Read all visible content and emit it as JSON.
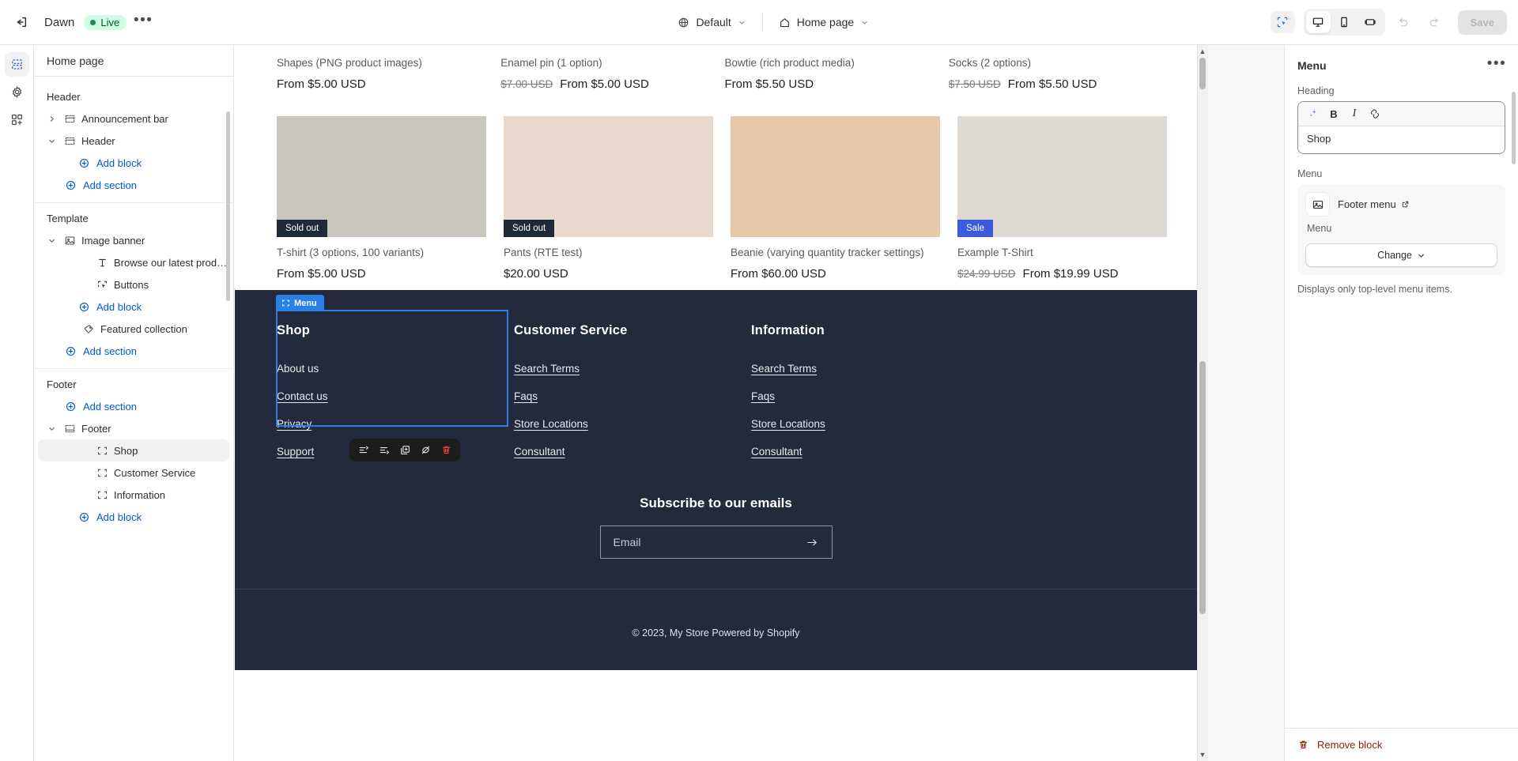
{
  "topbar": {
    "exit_icon": "exit-icon",
    "theme_name": "Dawn",
    "live_label": "Live",
    "more_label": "•••",
    "locale_selector": {
      "icon": "globe-icon",
      "value": "Default",
      "chevron": "chevron-down-icon"
    },
    "page_selector": {
      "icon": "home-icon",
      "value": "Home page",
      "chevron": "chevron-down-icon"
    },
    "view_modes": [
      {
        "name": "select-mode",
        "icon": "cursor-select-icon",
        "active": true
      },
      {
        "name": "desktop",
        "icon": "desktop-icon",
        "active": true
      },
      {
        "name": "mobile",
        "icon": "mobile-icon",
        "active": false
      },
      {
        "name": "fullscreen",
        "icon": "fullwidth-icon",
        "active": false
      }
    ],
    "undo_label": "undo-icon",
    "redo_label": "redo-icon",
    "save_label": "Save"
  },
  "rail": [
    {
      "name": "sections-icon",
      "label": "Sections",
      "active": true
    },
    {
      "name": "gear-icon",
      "label": "Theme settings",
      "active": false
    },
    {
      "name": "apps-icon",
      "label": "Apps",
      "active": false
    }
  ],
  "sidebar": {
    "header_title": "Home page",
    "groups": [
      {
        "title": "Header",
        "rows": [
          {
            "label": "Announcement bar",
            "icon": "section-icon",
            "caret": "chevron-right-icon",
            "indent": 1,
            "selected": false
          },
          {
            "label": "Header",
            "icon": "section-icon",
            "caret": "chevron-down-icon",
            "indent": 1,
            "selected": false
          },
          {
            "label": "Add block",
            "icon": "plus-circle-icon",
            "link": true,
            "indent": 3
          },
          {
            "label": "Add section",
            "icon": "plus-circle-icon",
            "link": true,
            "indent": 2
          }
        ]
      },
      {
        "title": "Template",
        "rows": [
          {
            "label": "Image banner",
            "icon": "image-icon",
            "caret": "chevron-down-icon",
            "indent": 1,
            "selected": false
          },
          {
            "label": "Browse our latest products",
            "icon": "text-icon",
            "indent": 3,
            "selected": false
          },
          {
            "label": "Buttons",
            "icon": "button-icon",
            "indent": 3,
            "selected": false
          },
          {
            "label": "Add block",
            "icon": "plus-circle-icon",
            "link": true,
            "indent": 3
          },
          {
            "label": "Featured collection",
            "icon": "collection-icon",
            "indent": 2,
            "selected": false
          },
          {
            "label": "Add section",
            "icon": "plus-circle-icon",
            "link": true,
            "indent": 2
          }
        ]
      },
      {
        "title": "Footer",
        "rows": [
          {
            "label": "Add section",
            "icon": "plus-circle-icon",
            "link": true,
            "indent": 2
          },
          {
            "label": "Footer",
            "icon": "footer-icon",
            "caret": "chevron-down-icon",
            "indent": 1,
            "selected": false
          },
          {
            "label": "Shop",
            "icon": "block-icon",
            "indent": 3,
            "selected": true
          },
          {
            "label": "Customer Service",
            "icon": "block-icon",
            "indent": 3,
            "selected": false
          },
          {
            "label": "Information",
            "icon": "block-icon",
            "indent": 3,
            "selected": false
          },
          {
            "label": "Add block",
            "icon": "plus-circle-icon",
            "link": true,
            "indent": 3
          }
        ]
      }
    ]
  },
  "preview": {
    "products_row1": [
      {
        "title": "Shapes (PNG product images)",
        "price": "From $5.00 USD",
        "compare_at": ""
      },
      {
        "title": "Enamel pin (1 option)",
        "price": "From $5.00 USD",
        "compare_at": "$7.00 USD"
      },
      {
        "title": "Bowtie (rich product media)",
        "price": "From $5.50 USD",
        "compare_at": ""
      },
      {
        "title": "Socks (2 options)",
        "price": "From $5.50 USD",
        "compare_at": "$7.50 USD"
      }
    ],
    "products_row2": [
      {
        "title": "T-shirt (3 options, 100 variants)",
        "price": "From $5.00 USD",
        "compare_at": "",
        "badge": "Sold out",
        "badge_type": "soldout",
        "img": "img-tshirts"
      },
      {
        "title": "Pants (RTE test)",
        "price": "$20.00 USD",
        "compare_at": "",
        "badge": "Sold out",
        "badge_type": "soldout",
        "img": "img-pants"
      },
      {
        "title": "Beanie (varying quantity tracker settings)",
        "price": "From $60.00 USD",
        "compare_at": "",
        "badge": "",
        "badge_type": "",
        "img": "img-beanie"
      },
      {
        "title": "Example T-Shirt",
        "price": "From $19.99 USD",
        "compare_at": "$24.99 USD",
        "badge": "Sale",
        "badge_type": "sale",
        "img": "img-greentee"
      }
    ],
    "footer": {
      "columns": [
        {
          "title": "Shop",
          "selected": true,
          "tag_label": "Menu",
          "links": [
            {
              "label": "About us",
              "underline": false
            },
            {
              "label": "Contact us",
              "underline": true
            },
            {
              "label": "Privacy",
              "underline": true
            },
            {
              "label": "Support",
              "underline": true
            }
          ]
        },
        {
          "title": "Customer Service",
          "selected": false,
          "links": [
            {
              "label": "Search Terms",
              "underline": true
            },
            {
              "label": "Faqs",
              "underline": true
            },
            {
              "label": "Store Locations",
              "underline": true
            },
            {
              "label": "Consultant",
              "underline": true
            }
          ]
        },
        {
          "title": "Information",
          "selected": false,
          "links": [
            {
              "label": "Search Terms",
              "underline": true
            },
            {
              "label": "Faqs",
              "underline": true
            },
            {
              "label": "Store Locations",
              "underline": true
            },
            {
              "label": "Consultant",
              "underline": true
            }
          ]
        }
      ],
      "toolbar_buttons": [
        {
          "name": "move-up-icon"
        },
        {
          "name": "move-down-icon"
        },
        {
          "name": "duplicate-icon"
        },
        {
          "name": "hide-icon"
        },
        {
          "name": "delete-icon"
        }
      ],
      "subscribe_title": "Subscribe to our emails",
      "email_placeholder": "Email",
      "submit_icon": "arrow-right-icon",
      "copyright": "© 2023, My Store Powered by Shopify"
    }
  },
  "rightpanel": {
    "title": "Menu",
    "more_icon": "ellipsis-icon",
    "heading_label": "Heading",
    "rte_buttons": [
      {
        "name": "ai-sparkle-icon",
        "glyph": "✦"
      },
      {
        "name": "bold-icon",
        "glyph": "B"
      },
      {
        "name": "italic-icon",
        "glyph": "I"
      },
      {
        "name": "link-icon",
        "glyph": "🔗"
      }
    ],
    "heading_value": "Shop",
    "menu_label": "Menu",
    "menu_card": {
      "thumb_icon": "image-placeholder-icon",
      "name": "Footer menu",
      "external_icon": "external-link-icon",
      "subtitle": "Menu",
      "change_label": "Change",
      "change_chevron": "chevron-down-icon"
    },
    "help_text": "Displays only top-level menu items.",
    "remove_label": "Remove block",
    "remove_icon": "trash-icon"
  },
  "colors": {
    "accent_blue": "#005bd3",
    "select_blue": "#2b7fe8",
    "footer_bg": "#232a3b",
    "sale_badge": "#3b5bdb",
    "soldout_badge": "#1f2937",
    "live_green": "#29845a",
    "danger": "#8e1f0b"
  }
}
